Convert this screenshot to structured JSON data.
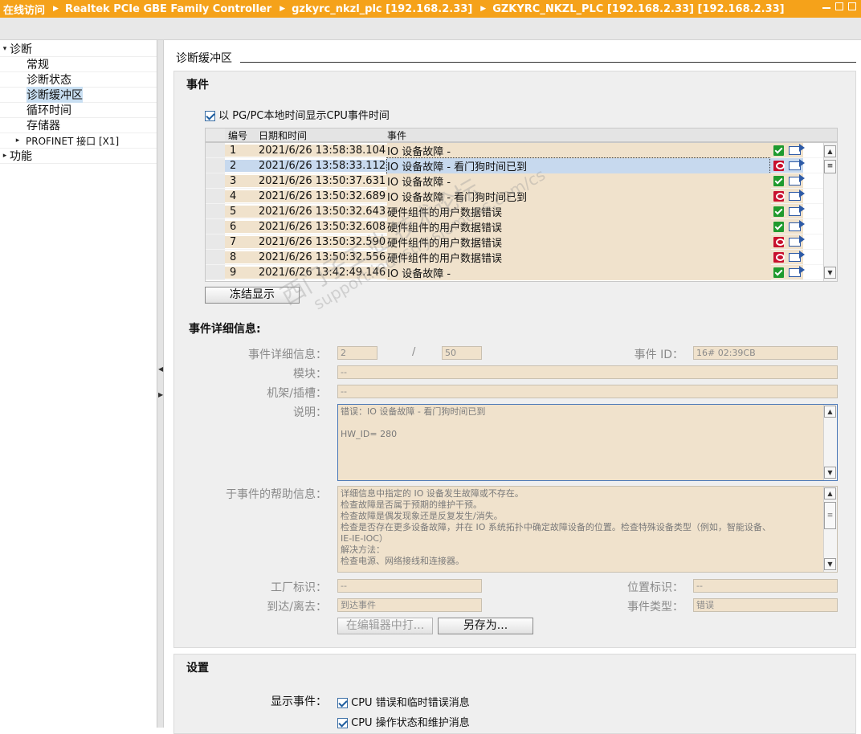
{
  "titlebar": {
    "segments": [
      "在线访问",
      "Realtek PCIe GBE Family Controller",
      "gzkyrc_nkzl_plc [192.168.2.33]",
      "GZKYRC_NKZL_PLC [192.168.2.33] [192.168.2.33]"
    ]
  },
  "tree": {
    "items": [
      {
        "label": "诊断",
        "twisty": "▾"
      },
      {
        "label": "常规"
      },
      {
        "label": "诊断状态"
      },
      {
        "label": "诊断缓冲区"
      },
      {
        "label": "循环时间"
      },
      {
        "label": "存储器"
      },
      {
        "label": "PROFINET 接口 [X1]",
        "twisty": "▸"
      },
      {
        "label": "功能",
        "twisty": "▸"
      }
    ]
  },
  "section_title": "诊断缓冲区",
  "events_panel": {
    "title": "事件",
    "local_time_checkbox": "以 PG/PC本地时间显示CPU事件时间",
    "columns": [
      "编号",
      "日期和时间",
      "事件"
    ],
    "rows": [
      {
        "no": "1",
        "datetime": "2021/6/26 13:58:38.104",
        "event": "IO 设备故障 -",
        "status": "ok"
      },
      {
        "no": "2",
        "datetime": "2021/6/26 13:58:33.112",
        "event": "IO 设备故障 - 看门狗时间已到",
        "status": "error"
      },
      {
        "no": "3",
        "datetime": "2021/6/26 13:50:37.631",
        "event": "IO 设备故障 -",
        "status": "ok"
      },
      {
        "no": "4",
        "datetime": "2021/6/26 13:50:32.689",
        "event": "IO 设备故障 - 看门狗时间已到",
        "status": "error"
      },
      {
        "no": "5",
        "datetime": "2021/6/26 13:50:32.643",
        "event": "硬件组件的用户数据错误",
        "status": "ok"
      },
      {
        "no": "6",
        "datetime": "2021/6/26 13:50:32.608",
        "event": "硬件组件的用户数据错误",
        "status": "ok"
      },
      {
        "no": "7",
        "datetime": "2021/6/26 13:50:32.590",
        "event": "硬件组件的用户数据错误",
        "status": "error"
      },
      {
        "no": "8",
        "datetime": "2021/6/26 13:50:32.556",
        "event": "硬件组件的用户数据错误",
        "status": "error"
      },
      {
        "no": "9",
        "datetime": "2021/6/26 13:42:49.146",
        "event": "IO 设备故障 -",
        "status": "ok"
      }
    ],
    "freeze_button": "冻结显示"
  },
  "details": {
    "title": "事件详细信息:",
    "detail_label": "事件详细信息：",
    "detail_value": "2",
    "detail_sep": "/",
    "detail_total": "50",
    "event_id_label": "事件 ID：",
    "event_id_value": "16# 02:39CB",
    "module_label": "模块：",
    "module_value": "--",
    "rack_label": "机架/插槽：",
    "rack_value": "--",
    "desc_label": "说明：",
    "desc_lines": [
      "错误：IO 设备故障 - 看门狗时间已到",
      "",
      "HW_ID=  280"
    ],
    "help_label": "于事件的帮助信息：",
    "help_lines": [
      "详细信息中指定的 IO 设备发生故障或不存在。",
      "检查故障是否属于预期的维护干预。",
      "检查故障是偶发现象还是反复发生/消失。",
      "检查是否存在更多设备故障，并在 IO 系统拓扑中确定故障设备的位置。检查特殊设备类型（例如，智能设备、",
      "IE-IE-IOC）",
      "解决方法：",
      "检查电源、网络接线和连接器。"
    ],
    "plant_label": "工厂标识：",
    "plant_value": "--",
    "location_label": "位置标识：",
    "location_value": "--",
    "arrival_label": "到达/离去：",
    "arrival_value": "到达事件",
    "eventtype_label": "事件类型：",
    "eventtype_value": "错误",
    "open_editor_button": "在编辑器中打...",
    "save_as_button": "另存为..."
  },
  "settings": {
    "title": "设置",
    "show_events_label": "显示事件：",
    "options": [
      "CPU 错误和临时错误消息",
      "CPU 操作状态和维护消息"
    ]
  },
  "watermark": {
    "text": "西门子工业 技术论坛",
    "url": "support.industry.siemens.com/cs"
  },
  "colors": {
    "titlebar": "#f5a21a",
    "field_bg": "#f0e2cc",
    "selected_row": "#c7d9ee",
    "ok_icon": "#1f9a2e",
    "error_icon": "#c8102e"
  }
}
